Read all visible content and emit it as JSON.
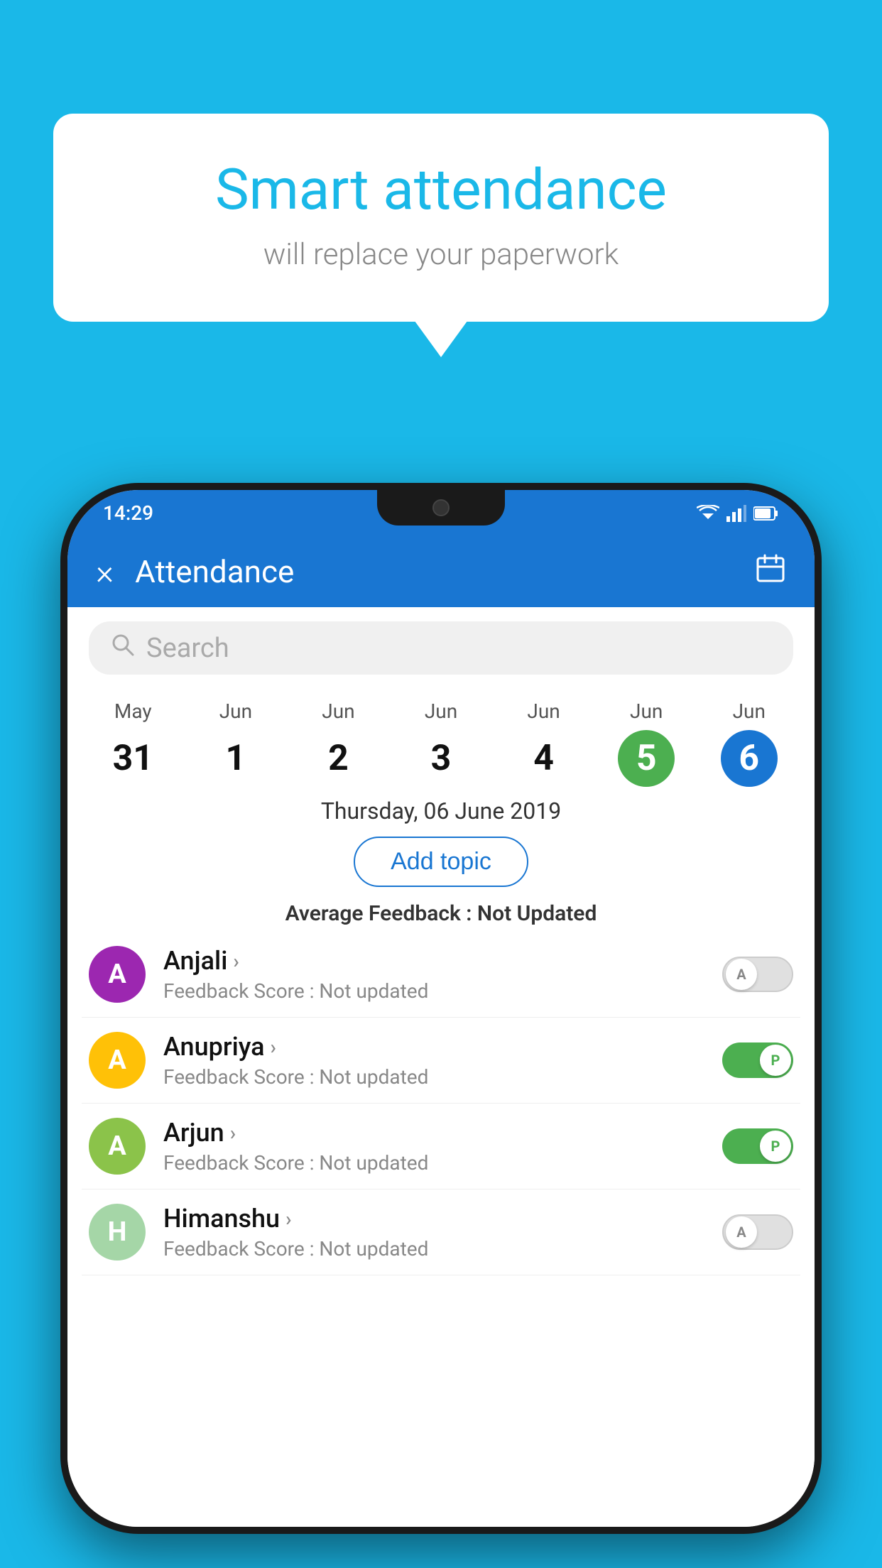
{
  "background_color": "#1ab8e8",
  "speech_bubble": {
    "title": "Smart attendance",
    "subtitle": "will replace your paperwork"
  },
  "status_bar": {
    "time": "14:29"
  },
  "app_bar": {
    "title": "Attendance",
    "close_label": "×",
    "calendar_label": "📅"
  },
  "search": {
    "placeholder": "Search"
  },
  "calendar": {
    "days": [
      {
        "month": "May",
        "num": "31",
        "active": false,
        "style": "plain"
      },
      {
        "month": "Jun",
        "num": "1",
        "active": false,
        "style": "plain"
      },
      {
        "month": "Jun",
        "num": "2",
        "active": false,
        "style": "plain"
      },
      {
        "month": "Jun",
        "num": "3",
        "active": false,
        "style": "plain"
      },
      {
        "month": "Jun",
        "num": "4",
        "active": false,
        "style": "plain"
      },
      {
        "month": "Jun",
        "num": "5",
        "active": true,
        "style": "green"
      },
      {
        "month": "Jun",
        "num": "6",
        "active": true,
        "style": "blue"
      }
    ],
    "selected_date": "Thursday, 06 June 2019"
  },
  "add_topic_btn": "Add topic",
  "avg_feedback_label": "Average Feedback : ",
  "avg_feedback_value": "Not Updated",
  "students": [
    {
      "name": "Anjali",
      "avatar_letter": "A",
      "avatar_color": "#9c27b0",
      "feedback_label": "Feedback Score : ",
      "feedback_value": "Not updated",
      "toggle": "off",
      "toggle_letter": "A"
    },
    {
      "name": "Anupriya",
      "avatar_letter": "A",
      "avatar_color": "#ffc107",
      "feedback_label": "Feedback Score : ",
      "feedback_value": "Not updated",
      "toggle": "on",
      "toggle_letter": "P"
    },
    {
      "name": "Arjun",
      "avatar_letter": "A",
      "avatar_color": "#8bc34a",
      "feedback_label": "Feedback Score : ",
      "feedback_value": "Not updated",
      "toggle": "on",
      "toggle_letter": "P"
    },
    {
      "name": "Himanshu",
      "avatar_letter": "H",
      "avatar_color": "#a5d6a7",
      "feedback_label": "Feedback Score : ",
      "feedback_value": "Not updated",
      "toggle": "off",
      "toggle_letter": "A"
    }
  ]
}
